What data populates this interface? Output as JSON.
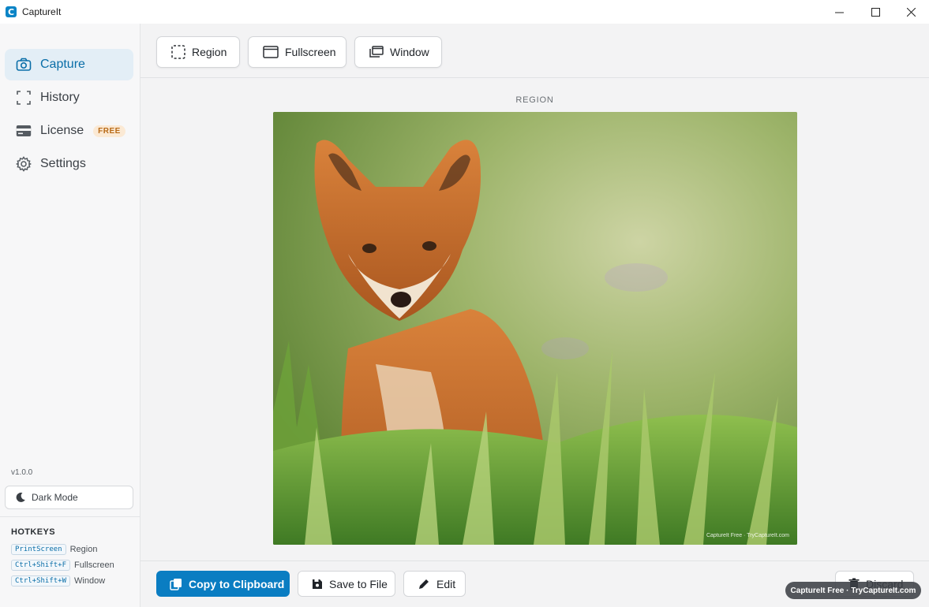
{
  "window": {
    "title": "CaptureIt",
    "logo_letter": "C",
    "controls": [
      "minimize-icon",
      "maximize-icon",
      "close-icon"
    ]
  },
  "sidebar": {
    "items": [
      {
        "label": "Capture",
        "icon": "camera-icon",
        "active": true
      },
      {
        "label": "History",
        "icon": "crop-frame-icon",
        "active": false
      },
      {
        "label": "License",
        "icon": "card-icon",
        "active": false,
        "badge": "FREE"
      },
      {
        "label": "Settings",
        "icon": "gear-icon",
        "active": false
      }
    ],
    "version": "v1.0.0",
    "dark_mode_label": "Dark Mode",
    "hotkeys": {
      "title": "HOTKEYS",
      "items": [
        {
          "key": "PrintScreen",
          "action": "Region"
        },
        {
          "key": "Ctrl+Shift+F",
          "action": "Fullscreen"
        },
        {
          "key": "Ctrl+Shift+W",
          "action": "Window"
        }
      ]
    }
  },
  "toolbar": {
    "modes": [
      {
        "label": "Region",
        "icon": "dashed-square-icon"
      },
      {
        "label": "Fullscreen",
        "icon": "monitor-icon"
      },
      {
        "label": "Window",
        "icon": "windows-stack-icon"
      }
    ]
  },
  "preview": {
    "label": "REGION",
    "watermark": "CaptureIt Free · TryCaptureIt.com"
  },
  "actions": {
    "copy": "Copy to Clipboard",
    "save": "Save to File",
    "edit": "Edit",
    "discard": "Discard"
  },
  "watermark_pill": "CaptureIt Free · TryCaptureIt.com",
  "colors": {
    "accent": "#0a7dc2",
    "active_bg": "#e3eef6",
    "badge_text": "#b86a16",
    "badge_bg": "#fbe9d4"
  }
}
